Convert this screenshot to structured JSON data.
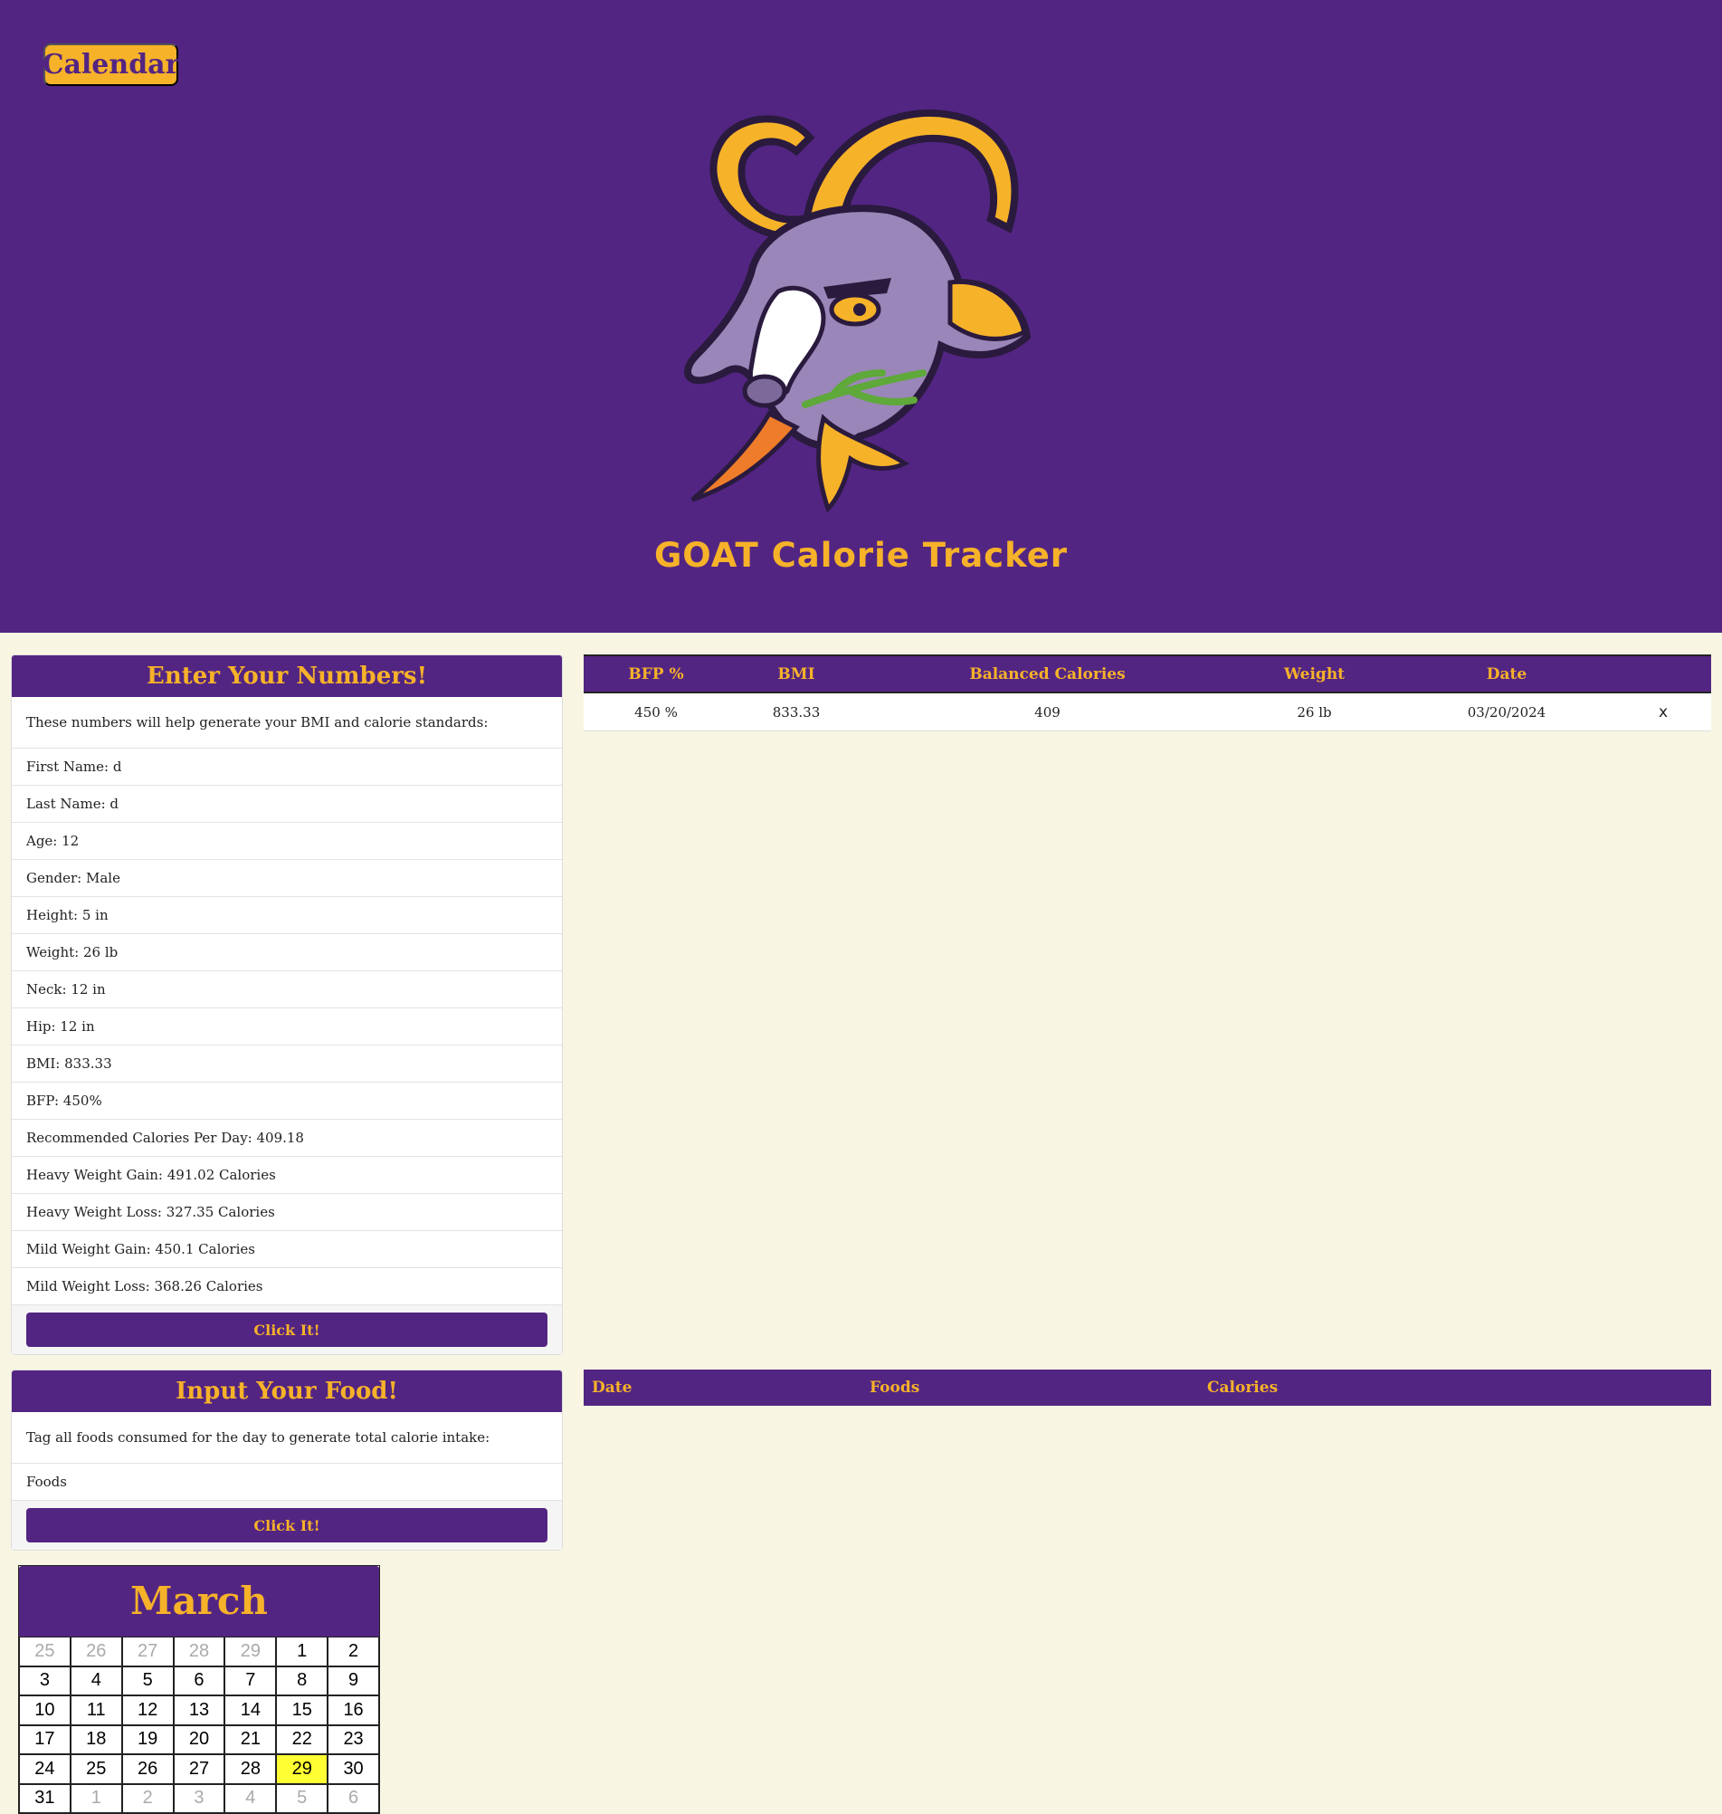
{
  "header": {
    "calendar_button": "Calendar",
    "site_title": "GOAT Calorie Tracker",
    "colors": {
      "primary": "#532582",
      "accent": "#f6b229",
      "background": "#f8f6e3"
    }
  },
  "numbers_card": {
    "title": "Enter Your Numbers!",
    "description": "These numbers will help generate your BMI and calorie standards:",
    "rows": [
      "First Name: d",
      "Last Name: d",
      "Age: 12",
      "Gender: Male",
      "Height: 5 in",
      "Weight: 26 lb",
      "Neck: 12 in",
      "Hip: 12 in",
      "BMI: 833.33",
      "BFP: 450%",
      "Recommended Calories Per Day: 409.18",
      "Heavy Weight Gain: 491.02 Calories",
      "Heavy Weight Loss: 327.35 Calories",
      "Mild Weight Gain: 450.1 Calories",
      "Mild Weight Loss: 368.26 Calories"
    ],
    "button": "Click It!"
  },
  "food_card": {
    "title": "Input Your Food!",
    "description": "Tag all foods consumed for the day to generate total calorie intake:",
    "foods_label": "Foods",
    "button": "Click It!"
  },
  "stats_table": {
    "headers": [
      "BFP %",
      "BMI",
      "Balanced Calories",
      "Weight",
      "Date"
    ],
    "rows": [
      {
        "bfp": "450 %",
        "bmi": "833.33",
        "calories": "409",
        "weight": "26 lb",
        "date": "03/20/2024",
        "delete": "x"
      }
    ]
  },
  "food_table": {
    "headers": [
      "Date",
      "Foods",
      "Calories"
    ]
  },
  "calendar": {
    "month": "March",
    "today": "29",
    "days": [
      {
        "d": "25",
        "m": true
      },
      {
        "d": "26",
        "m": true
      },
      {
        "d": "27",
        "m": true
      },
      {
        "d": "28",
        "m": true
      },
      {
        "d": "29",
        "m": true
      },
      {
        "d": "1"
      },
      {
        "d": "2"
      },
      {
        "d": "3"
      },
      {
        "d": "4"
      },
      {
        "d": "5"
      },
      {
        "d": "6"
      },
      {
        "d": "7"
      },
      {
        "d": "8"
      },
      {
        "d": "9"
      },
      {
        "d": "10"
      },
      {
        "d": "11"
      },
      {
        "d": "12"
      },
      {
        "d": "13"
      },
      {
        "d": "14"
      },
      {
        "d": "15"
      },
      {
        "d": "16"
      },
      {
        "d": "17"
      },
      {
        "d": "18"
      },
      {
        "d": "19"
      },
      {
        "d": "20"
      },
      {
        "d": "21"
      },
      {
        "d": "22"
      },
      {
        "d": "23"
      },
      {
        "d": "24"
      },
      {
        "d": "25"
      },
      {
        "d": "26"
      },
      {
        "d": "27"
      },
      {
        "d": "28"
      },
      {
        "d": "29",
        "t": true
      },
      {
        "d": "30"
      },
      {
        "d": "31"
      },
      {
        "d": "1",
        "m": true
      },
      {
        "d": "2",
        "m": true
      },
      {
        "d": "3",
        "m": true
      },
      {
        "d": "4",
        "m": true
      },
      {
        "d": "5",
        "m": true
      },
      {
        "d": "6",
        "m": true
      }
    ]
  }
}
